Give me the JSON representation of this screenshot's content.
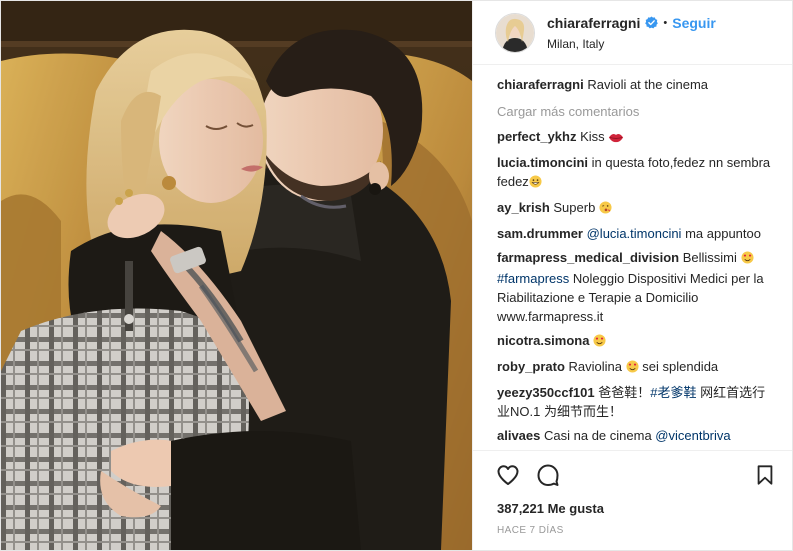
{
  "header": {
    "username": "chiaraferragni",
    "separator": "•",
    "follow_label": "Seguir",
    "location": "Milan, Italy"
  },
  "caption": {
    "username": "chiaraferragni",
    "text": "Ravioli at the cinema"
  },
  "load_more_label": "Cargar más comentarios",
  "comments": [
    {
      "user": "perfect_ykhz",
      "text": "Kiss",
      "emoji": "lips"
    },
    {
      "user": "lucia.timoncini",
      "text": "in questa foto,fedez nn sembra fedez",
      "emoji": "grin"
    },
    {
      "user": "ay_krish",
      "text": "Superb",
      "emoji": "kiss-face"
    },
    {
      "user": "sam.drummer",
      "mention": "@lucia.timoncini",
      "text": "ma appuntoo"
    },
    {
      "user": "farmapress_medical_division",
      "text": "Bellissimi",
      "emoji": "heart-eyes",
      "tag": "#farmapress",
      "text2": "Noleggio Dispositivi Medici per la Riabilitazione e Terapie a Domicilio www.farmapress.it"
    },
    {
      "user": "nicotra.simona",
      "text": "",
      "emoji": "heart-eyes"
    },
    {
      "user": "roby_prato",
      "text": "Raviolina",
      "emoji": "heart-eyes",
      "text2": "sei splendida"
    },
    {
      "user": "yeezy350ccf101",
      "text": "爸爸鞋！",
      "tag": "#老爹鞋",
      "text2": "网红首选行业NO.1 为细节而生！"
    },
    {
      "user": "alivaes",
      "text": "Casi na de cinema",
      "mention": "@vicentbriva"
    }
  ],
  "actions": {
    "like_icon": "heart-icon",
    "comment_icon": "comment-icon",
    "save_icon": "bookmark-icon"
  },
  "likes": "387,221 Me gusta",
  "time": "HACE 7 DÍAS",
  "colors": {
    "link": "#3897f0",
    "mention": "#003569",
    "muted": "#999999",
    "text": "#262626",
    "verified": "#3897f0"
  }
}
